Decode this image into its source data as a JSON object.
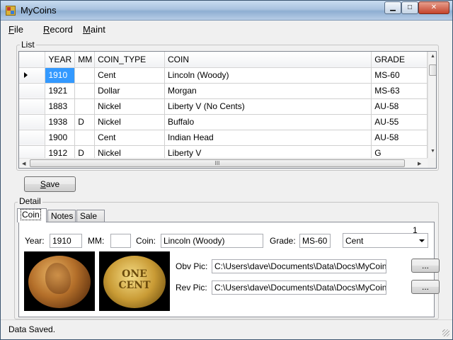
{
  "window": {
    "title": "MyCoins",
    "minimize_icon": "minimize-icon",
    "maximize_icon": "maximize-icon",
    "close_icon": "close-icon"
  },
  "menu": [
    {
      "label": "File",
      "accel": "F",
      "rest": "ile"
    },
    {
      "label": "Record",
      "accel": "R",
      "rest": "ecord"
    },
    {
      "label": "Maint",
      "accel": "M",
      "rest": "aint"
    }
  ],
  "list": {
    "group_label": "List",
    "columns": [
      "YEAR",
      "MM",
      "COIN_TYPE",
      "COIN",
      "GRADE"
    ],
    "rows": [
      {
        "year": "1910",
        "mm": "",
        "coin_type": "Cent",
        "coin": "Lincoln (Woody)",
        "grade": "MS-60"
      },
      {
        "year": "1921",
        "mm": "",
        "coin_type": "Dollar",
        "coin": "Morgan",
        "grade": "MS-63"
      },
      {
        "year": "1883",
        "mm": "",
        "coin_type": "Nickel",
        "coin": "Liberty V (No Cents)",
        "grade": "AU-58"
      },
      {
        "year": "1938",
        "mm": "D",
        "coin_type": "Nickel",
        "coin": "Buffalo",
        "grade": "AU-55"
      },
      {
        "year": "1900",
        "mm": "",
        "coin_type": "Cent",
        "coin": "Indian Head",
        "grade": "AU-58"
      },
      {
        "year": "1912",
        "mm": "D",
        "coin_type": "Nickel",
        "coin": "Liberty V",
        "grade": "G"
      }
    ],
    "selected_row": 0,
    "scroll_grip": "III"
  },
  "save_button": {
    "label": "Save",
    "accel": "S",
    "rest": "ave"
  },
  "detail": {
    "group_label": "Detail",
    "tabs": [
      "Coin",
      "Notes",
      "Sale"
    ],
    "active_tab": "Coin",
    "record_number": "1",
    "year_label": "Year:",
    "year_value": "1910",
    "mm_label": "MM:",
    "mm_value": "",
    "coin_label": "Coin:",
    "coin_value": "Lincoln (Woody)",
    "grade_label": "Grade:",
    "grade_value": "MS-60",
    "coin_type_selected": "Cent",
    "obv_pic_label": "Obv Pic:",
    "obv_pic_value": "C:\\Users\\dave\\Documents\\Data\\Docs\\MyCoinCo",
    "rev_pic_label": "Rev Pic:",
    "rev_pic_value": "C:\\Users\\dave\\Documents\\Data\\Docs\\MyCoinCo",
    "browse_label": "...",
    "rev_coin_text": [
      "ONE",
      "CENT"
    ]
  },
  "status": {
    "text": "Data Saved."
  }
}
